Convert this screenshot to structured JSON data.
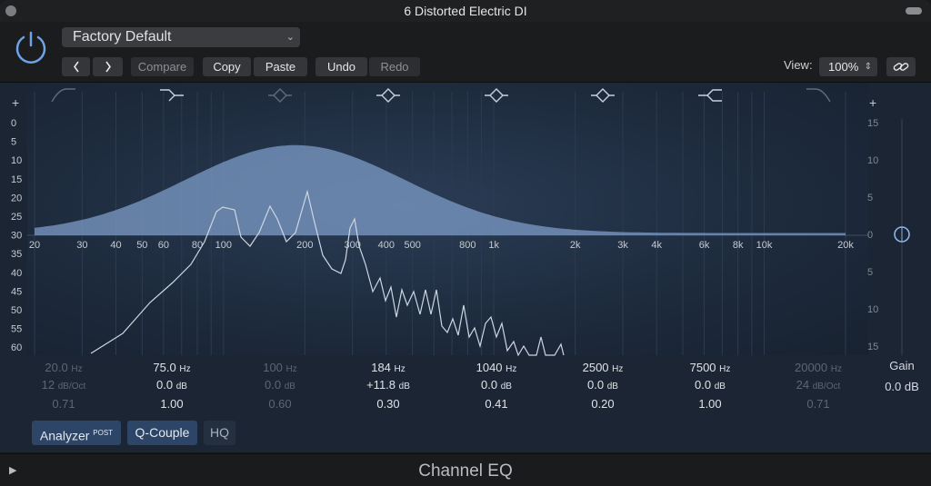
{
  "window": {
    "title": "6 Distorted Electric DI"
  },
  "header": {
    "preset": "Factory Default",
    "prev_icon": "chevron-left-icon",
    "next_icon": "chevron-right-icon",
    "compare_label": "Compare",
    "copy_label": "Copy",
    "paste_label": "Paste",
    "undo_label": "Undo",
    "redo_label": "Redo",
    "view_label": "View:",
    "zoom_value": "100%",
    "link_icon": "link-icon"
  },
  "eq": {
    "add_left": "+",
    "add_right": "+",
    "band_shapes": [
      "low-cut-icon",
      "low-shelf-icon",
      "bell-icon",
      "bell-icon",
      "bell-icon",
      "bell-icon",
      "high-shelf-icon",
      "high-cut-icon"
    ],
    "left_scale": [
      "0",
      "5",
      "10",
      "15",
      "20",
      "25",
      "30",
      "35",
      "40",
      "45",
      "50",
      "55",
      "60"
    ],
    "right_scale_top": [
      "15",
      "10",
      "5",
      "0"
    ],
    "right_scale_bottom": [
      "5",
      "10",
      "15"
    ],
    "freq_labels": [
      "20",
      "30",
      "40",
      "50",
      "60",
      "80",
      "100",
      "200",
      "300",
      "400",
      "500",
      "800",
      "1k",
      "2k",
      "3k",
      "4k",
      "6k",
      "8k",
      "10k",
      "20k"
    ],
    "bands": [
      {
        "freq": "20.0",
        "freq_unit": "Hz",
        "gain": "12",
        "gain_unit": "dB/Oct",
        "q": "0.71",
        "active": false
      },
      {
        "freq": "75.0",
        "freq_unit": "Hz",
        "gain": "0.0",
        "gain_unit": "dB",
        "q": "1.00",
        "active": true
      },
      {
        "freq": "100",
        "freq_unit": "Hz",
        "gain": "0.0",
        "gain_unit": "dB",
        "q": "0.60",
        "active": false
      },
      {
        "freq": "184",
        "freq_unit": "Hz",
        "gain": "+11.8",
        "gain_unit": "dB",
        "q": "0.30",
        "active": true
      },
      {
        "freq": "1040",
        "freq_unit": "Hz",
        "gain": "0.0",
        "gain_unit": "dB",
        "q": "0.41",
        "active": true
      },
      {
        "freq": "2500",
        "freq_unit": "Hz",
        "gain": "0.0",
        "gain_unit": "dB",
        "q": "0.20",
        "active": true
      },
      {
        "freq": "7500",
        "freq_unit": "Hz",
        "gain": "0.0",
        "gain_unit": "dB",
        "q": "1.00",
        "active": true
      },
      {
        "freq": "20000",
        "freq_unit": "Hz",
        "gain": "24",
        "gain_unit": "dB/Oct",
        "q": "0.71",
        "active": false
      }
    ],
    "gain_label": "Gain",
    "gain_value": "0.0 dB",
    "analyzer_label": "Analyzer",
    "analyzer_sup": "POST",
    "qcouple_label": "Q-Couple",
    "hq_label": "HQ",
    "curve_color": "#7d9cc7",
    "analyzer_color": "#cdd6e3"
  },
  "footer": {
    "plugin_name": "Channel EQ"
  }
}
